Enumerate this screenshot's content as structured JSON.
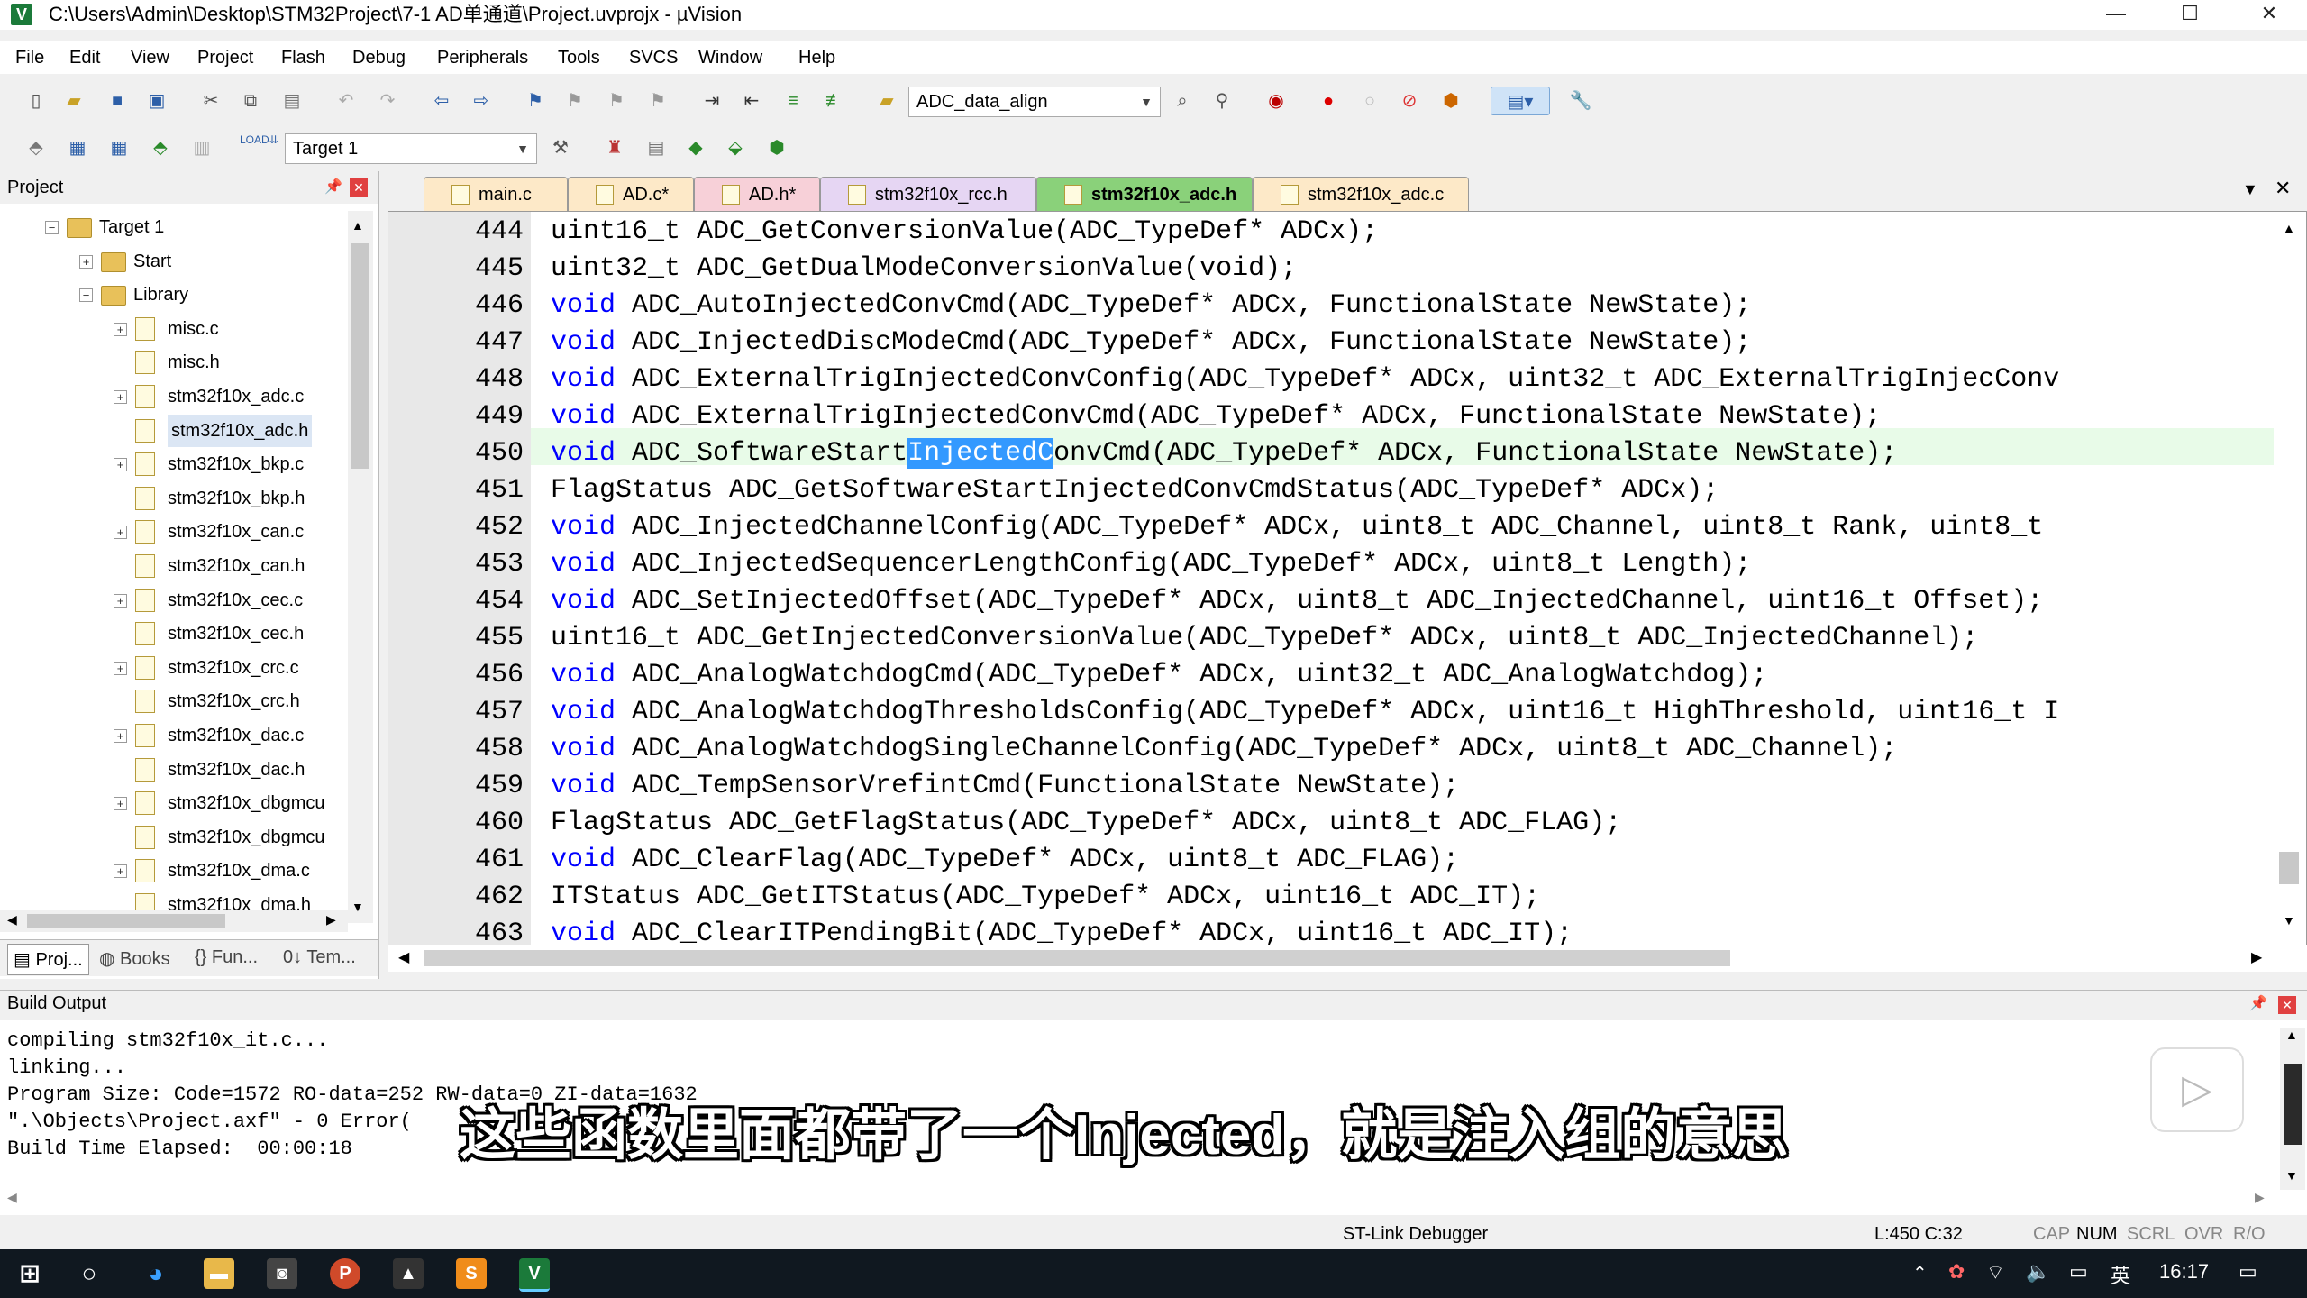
{
  "window": {
    "title": "C:\\Users\\Admin\\Desktop\\STM32Project\\7-1 AD单通道\\Project.uvprojx - µVision",
    "app_icon": "V"
  },
  "menu": [
    "File",
    "Edit",
    "View",
    "Project",
    "Flash",
    "Debug",
    "Peripherals",
    "Tools",
    "SVCS",
    "Window",
    "Help"
  ],
  "toolbar": {
    "find_combo": "ADC_data_align",
    "target_combo": "Target 1"
  },
  "project": {
    "header": "Project",
    "tree": [
      {
        "label": "Target 1",
        "level": 0,
        "type": "folder",
        "expander": "−"
      },
      {
        "label": "Start",
        "level": 1,
        "type": "folder",
        "expander": "+"
      },
      {
        "label": "Library",
        "level": 1,
        "type": "folder",
        "expander": "−"
      },
      {
        "label": "misc.c",
        "level": 2,
        "type": "file",
        "expander": "+"
      },
      {
        "label": "misc.h",
        "level": 2,
        "type": "file",
        "expander": ""
      },
      {
        "label": "stm32f10x_adc.c",
        "level": 2,
        "type": "file",
        "expander": "+"
      },
      {
        "label": "stm32f10x_adc.h",
        "level": 2,
        "type": "file",
        "expander": "",
        "selected": true
      },
      {
        "label": "stm32f10x_bkp.c",
        "level": 2,
        "type": "file",
        "expander": "+"
      },
      {
        "label": "stm32f10x_bkp.h",
        "level": 2,
        "type": "file",
        "expander": ""
      },
      {
        "label": "stm32f10x_can.c",
        "level": 2,
        "type": "file",
        "expander": "+"
      },
      {
        "label": "stm32f10x_can.h",
        "level": 2,
        "type": "file",
        "expander": ""
      },
      {
        "label": "stm32f10x_cec.c",
        "level": 2,
        "type": "file",
        "expander": "+"
      },
      {
        "label": "stm32f10x_cec.h",
        "level": 2,
        "type": "file",
        "expander": ""
      },
      {
        "label": "stm32f10x_crc.c",
        "level": 2,
        "type": "file",
        "expander": "+"
      },
      {
        "label": "stm32f10x_crc.h",
        "level": 2,
        "type": "file",
        "expander": ""
      },
      {
        "label": "stm32f10x_dac.c",
        "level": 2,
        "type": "file",
        "expander": "+"
      },
      {
        "label": "stm32f10x_dac.h",
        "level": 2,
        "type": "file",
        "expander": ""
      },
      {
        "label": "stm32f10x_dbgmcu",
        "level": 2,
        "type": "file",
        "expander": "+"
      },
      {
        "label": "stm32f10x_dbgmcu",
        "level": 2,
        "type": "file",
        "expander": ""
      },
      {
        "label": "stm32f10x_dma.c",
        "level": 2,
        "type": "file",
        "expander": "+"
      },
      {
        "label": "stm32f10x_dma.h",
        "level": 2,
        "type": "file",
        "expander": ""
      }
    ],
    "bottom_tabs": [
      "Proj...",
      "Books",
      "{} Fun...",
      "0↓ Tem..."
    ]
  },
  "tabs": [
    {
      "label": "main.c",
      "active": false
    },
    {
      "label": "AD.c*",
      "active": false
    },
    {
      "label": "AD.h*",
      "active": false
    },
    {
      "label": "stm32f10x_rcc.h",
      "active": false
    },
    {
      "label": "stm32f10x_adc.h",
      "active": true
    },
    {
      "label": "stm32f10x_adc.c",
      "active": false
    }
  ],
  "editor": {
    "lines": [
      {
        "n": "444",
        "kw": "uint16_t",
        "rest": " ADC_GetConversionValue(ADC_TypeDef* ADCx);",
        "kwblue": false
      },
      {
        "n": "445",
        "kw": "uint32_t",
        "rest": " ADC_GetDualModeConversionValue(void);",
        "kwblue": false
      },
      {
        "n": "446",
        "kw": "void",
        "rest": " ADC_AutoInjectedConvCmd(ADC_TypeDef* ADCx, FunctionalState NewState);",
        "kwblue": true
      },
      {
        "n": "447",
        "kw": "void",
        "rest": " ADC_InjectedDiscModeCmd(ADC_TypeDef* ADCx, FunctionalState NewState);",
        "kwblue": true
      },
      {
        "n": "448",
        "kw": "void",
        "rest": " ADC_ExternalTrigInjectedConvConfig(ADC_TypeDef* ADCx, uint32_t ADC_ExternalTrigInjecConv",
        "kwblue": true
      },
      {
        "n": "449",
        "kw": "void",
        "rest": " ADC_ExternalTrigInjectedConvCmd(ADC_TypeDef* ADCx, FunctionalState NewState);",
        "kwblue": true
      },
      {
        "n": "450",
        "kw": "void",
        "rest": "",
        "kwblue": true,
        "pre": " ADC_SoftwareStart",
        "sel": "InjectedC",
        "post": "onvCmd(ADC_TypeDef* ADCx, FunctionalState NewState);"
      },
      {
        "n": "451",
        "kw": "FlagStatus",
        "rest": " ADC_GetSoftwareStartInjectedConvCmdStatus(ADC_TypeDef* ADCx);",
        "kwblue": false
      },
      {
        "n": "452",
        "kw": "void",
        "rest": " ADC_InjectedChannelConfig(ADC_TypeDef* ADCx, uint8_t ADC_Channel, uint8_t Rank, uint8_t",
        "kwblue": true
      },
      {
        "n": "453",
        "kw": "void",
        "rest": " ADC_InjectedSequencerLengthConfig(ADC_TypeDef* ADCx, uint8_t Length);",
        "kwblue": true
      },
      {
        "n": "454",
        "kw": "void",
        "rest": " ADC_SetInjectedOffset(ADC_TypeDef* ADCx, uint8_t ADC_InjectedChannel, uint16_t Offset);",
        "kwblue": true
      },
      {
        "n": "455",
        "kw": "uint16_t",
        "rest": " ADC_GetInjectedConversionValue(ADC_TypeDef* ADCx, uint8_t ADC_InjectedChannel);",
        "kwblue": false
      },
      {
        "n": "456",
        "kw": "void",
        "rest": " ADC_AnalogWatchdogCmd(ADC_TypeDef* ADCx, uint32_t ADC_AnalogWatchdog);",
        "kwblue": true
      },
      {
        "n": "457",
        "kw": "void",
        "rest": " ADC_AnalogWatchdogThresholdsConfig(ADC_TypeDef* ADCx, uint16_t HighThreshold, uint16_t I",
        "kwblue": true
      },
      {
        "n": "458",
        "kw": "void",
        "rest": " ADC_AnalogWatchdogSingleChannelConfig(ADC_TypeDef* ADCx, uint8_t ADC_Channel);",
        "kwblue": true
      },
      {
        "n": "459",
        "kw": "void",
        "rest": " ADC_TempSensorVrefintCmd(FunctionalState NewState);",
        "kwblue": true
      },
      {
        "n": "460",
        "kw": "FlagStatus",
        "rest": " ADC_GetFlagStatus(ADC_TypeDef* ADCx, uint8_t ADC_FLAG);",
        "kwblue": false
      },
      {
        "n": "461",
        "kw": "void",
        "rest": " ADC_ClearFlag(ADC_TypeDef* ADCx, uint8_t ADC_FLAG);",
        "kwblue": true
      },
      {
        "n": "462",
        "kw": "ITStatus",
        "rest": " ADC_GetITStatus(ADC_TypeDef* ADCx, uint16_t ADC_IT);",
        "kwblue": false
      },
      {
        "n": "463",
        "kw": "void",
        "rest": " ADC_ClearITPendingBit(ADC_TypeDef* ADCx, uint16_t ADC_IT);",
        "kwblue": true
      }
    ]
  },
  "build": {
    "header": "Build Output",
    "lines": [
      "compiling stm32f10x_it.c...",
      "linking...",
      "Program Size: Code=1572 RO-data=252 RW-data=0 ZI-data=1632",
      "\".\\Objects\\Project.axf\" - 0 Error(",
      "Build Time Elapsed:  00:00:18"
    ]
  },
  "subtitle": "这些函数里面都带了一个Injected，就是注入组的意思",
  "status": {
    "debugger": "ST-Link Debugger",
    "position": "L:450 C:32",
    "flags": [
      "CAP",
      "NUM",
      "SCRL",
      "OVR",
      "R/O"
    ]
  },
  "taskbar": {
    "time": "16:17",
    "ime": "英"
  },
  "colors": {
    "keyword": "#0000ff",
    "selection": "#3399ff",
    "current_line": "#e8fbe8",
    "active_tab": "#8ad17a"
  }
}
